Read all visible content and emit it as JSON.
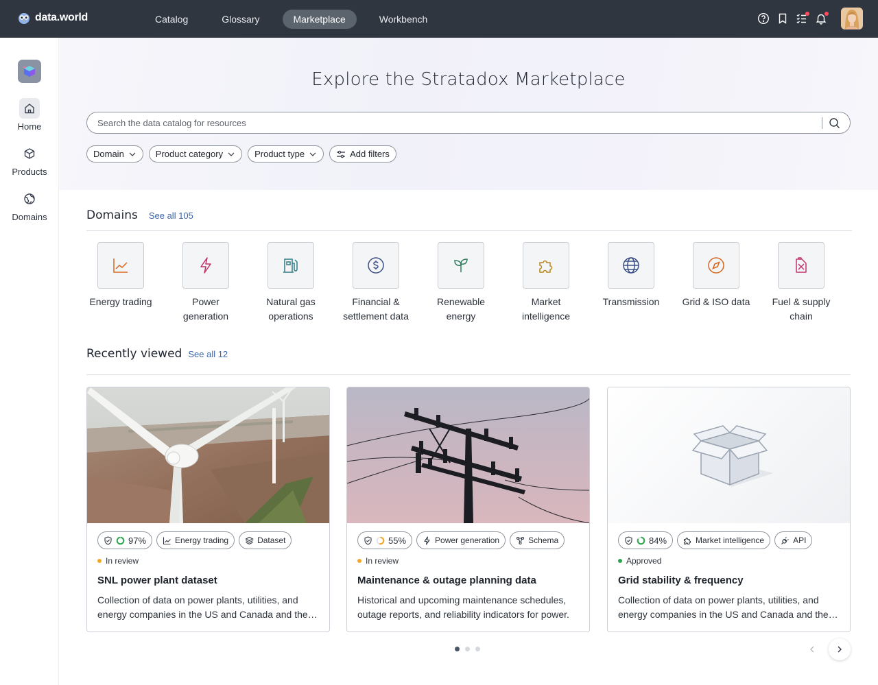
{
  "topbar": {
    "logo_text": "data.world",
    "nav": [
      "Catalog",
      "Glossary",
      "Marketplace",
      "Workbench"
    ],
    "active_nav": "Marketplace"
  },
  "sidebar": {
    "items": [
      {
        "label": "Home",
        "icon": "home-icon"
      },
      {
        "label": "Products",
        "icon": "cube-icon"
      },
      {
        "label": "Domains",
        "icon": "globe-icon"
      }
    ]
  },
  "hero": {
    "title": "Explore the Stratadox Marketplace",
    "search_placeholder": "Search the data catalog for resources",
    "filters": [
      "Domain",
      "Product category",
      "Product type",
      "Add filters"
    ]
  },
  "domains_section": {
    "title": "Domains",
    "see_all": "See all 105",
    "items": [
      {
        "label": "Energy trading",
        "icon": "line-chart-icon",
        "color": "#d9661f"
      },
      {
        "label": "Power generation",
        "icon": "lightning-icon",
        "color": "#c0336b"
      },
      {
        "label": "Natural gas operations",
        "icon": "fuel-pump-icon",
        "color": "#2e7d86"
      },
      {
        "label": "Financial & settlement data",
        "icon": "dollar-icon",
        "color": "#3b4f86"
      },
      {
        "label": "Renewable energy",
        "icon": "sprout-icon",
        "color": "#2e7d5a"
      },
      {
        "label": "Market intelligence",
        "icon": "puzzle-icon",
        "color": "#b8861b"
      },
      {
        "label": "Transmission",
        "icon": "globe-icon",
        "color": "#3b4f86"
      },
      {
        "label": "Grid & ISO data",
        "icon": "compass-icon",
        "color": "#d9661f"
      },
      {
        "label": "Fuel & supply chain",
        "icon": "fuel-can-icon",
        "color": "#c0336b"
      }
    ]
  },
  "recent_section": {
    "title": "Recently viewed",
    "see_all": "See all 12",
    "cards": [
      {
        "score": "97%",
        "score_value": 0.97,
        "score_color": "#2da44e",
        "domain": "Energy trading",
        "domain_icon": "line-chart-icon",
        "type": "Dataset",
        "type_icon": "layers-icon",
        "status": "In review",
        "status_color": "#f5a623",
        "title": "SNL power plant dataset",
        "desc": "Collection of data on power plants, utilities, and energy companies in the US and Canada and the broader North American market."
      },
      {
        "score": "55%",
        "score_value": 0.55,
        "score_color": "#f5a623",
        "domain": "Power generation",
        "domain_icon": "lightning-icon",
        "type": "Schema",
        "type_icon": "schema-icon",
        "status": "In review",
        "status_color": "#f5a623",
        "title": "Maintenance & outage planning data",
        "desc": "Historical and upcoming maintenance schedules, outage reports, and reliability indicators for power."
      },
      {
        "score": "84%",
        "score_value": 0.84,
        "score_color": "#2da44e",
        "domain": "Market intelligence",
        "domain_icon": "puzzle-icon",
        "type": "API",
        "type_icon": "plug-icon",
        "status": "Approved",
        "status_color": "#2da44e",
        "title": "Grid stability & frequency",
        "desc": "Collection of data on power plants, utilities, and energy companies in the US and Canada and the broader North American market."
      }
    ],
    "pages": 3,
    "current_page": 1
  }
}
